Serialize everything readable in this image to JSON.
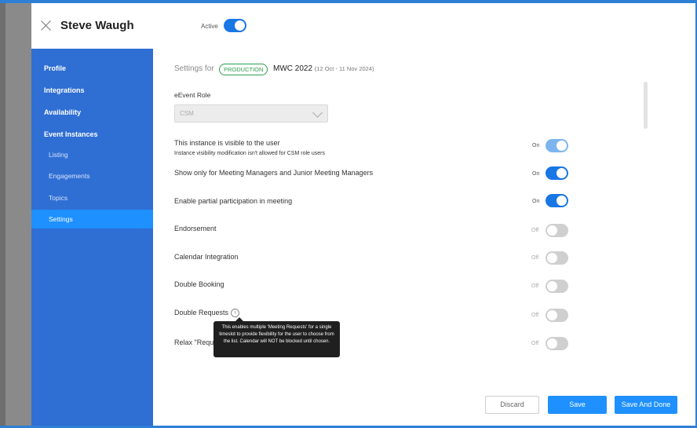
{
  "header": {
    "user_name": "Steve Waugh",
    "active_label": "Active",
    "active_on": true
  },
  "sidebar": {
    "items": [
      {
        "label": "Profile"
      },
      {
        "label": "Integrations"
      },
      {
        "label": "Availability"
      },
      {
        "label": "Event Instances"
      },
      {
        "label": "Listing"
      },
      {
        "label": "Engagements"
      },
      {
        "label": "Topics"
      },
      {
        "label": "Settings",
        "selected": true
      }
    ]
  },
  "settings": {
    "prefix": "Settings for",
    "badge": "PRODUCTION",
    "event_name": "MWC 2022",
    "event_dates": "(12 Oct - 11 Nov 2024)",
    "role_label": "eEvent Role",
    "role_value": "CSM"
  },
  "rows": [
    {
      "label": "This instance is visible to the user",
      "sublabel": "Instance visibility modification isn't allowed for CSM role users",
      "state": "On"
    },
    {
      "label": "Show only for Meeting Managers and Junior Meeting Managers",
      "state": "On"
    },
    {
      "label": "Enable partial participation in meeting",
      "state": "On"
    },
    {
      "label": "Endorsement",
      "state": "Off"
    },
    {
      "label": "Calendar Integration",
      "state": "Off"
    },
    {
      "label": "Double Booking",
      "state": "Off"
    },
    {
      "label": "Double Requests",
      "state": "Off",
      "info_icon": "i"
    },
    {
      "label": "Relax \"Requ",
      "state": "Off"
    }
  ],
  "tooltip": "This enables multiple 'Meeting Requests' for a single timeslot to provide flexibility for the user to choose from the list. Calendar will NOT be blocked until chosen.",
  "buttons": {
    "discard": "Discard",
    "save": "Save",
    "save_done": "Save And Done"
  },
  "colors": {
    "primary": "#1976e5",
    "sidebar": "#2f6ed3",
    "badge_green": "#2e9e4f"
  }
}
